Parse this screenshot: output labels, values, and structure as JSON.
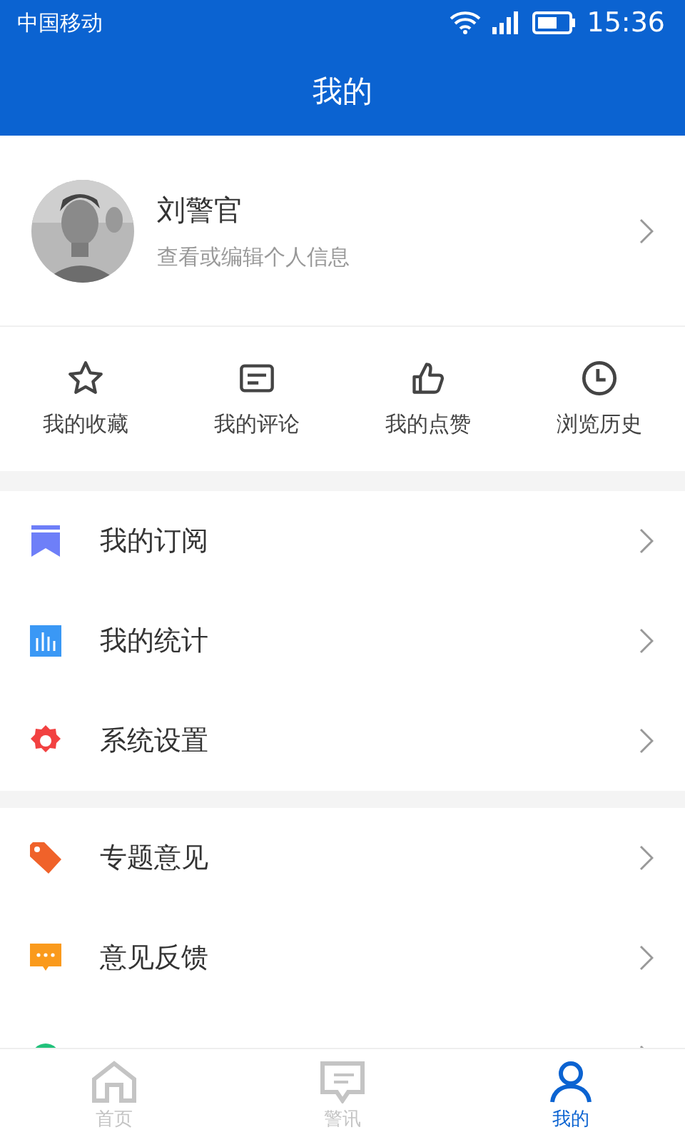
{
  "status_bar": {
    "carrier": "中国移动",
    "time": "15:36"
  },
  "header": {
    "title": "我的"
  },
  "profile": {
    "name": "刘警官",
    "subtitle": "查看或编辑个人信息"
  },
  "shortcuts": [
    {
      "kind": "star",
      "label": "我的收藏"
    },
    {
      "kind": "comment",
      "label": "我的评论"
    },
    {
      "kind": "thumb",
      "label": "我的点赞"
    },
    {
      "kind": "clock",
      "label": "浏览历史"
    }
  ],
  "menu_groups": [
    [
      {
        "kind": "bookmark",
        "label": "我的订阅",
        "color": "#6e7ff8"
      },
      {
        "kind": "chart",
        "label": "我的统计",
        "color": "#3a98f5"
      },
      {
        "kind": "gear",
        "label": "系统设置",
        "color": "#f24141"
      }
    ],
    [
      {
        "kind": "tag",
        "label": "专题意见",
        "color": "#f0622a"
      },
      {
        "kind": "chat",
        "label": "意见反馈",
        "color": "#fa9a1c"
      },
      {
        "kind": "dot",
        "color": "#21c17a"
      }
    ]
  ],
  "tab_bar": [
    {
      "kind": "home",
      "label": "首页",
      "selected": false
    },
    {
      "kind": "alert",
      "label": "警讯",
      "selected": false
    },
    {
      "kind": "person",
      "label": "我的",
      "selected": true
    }
  ]
}
